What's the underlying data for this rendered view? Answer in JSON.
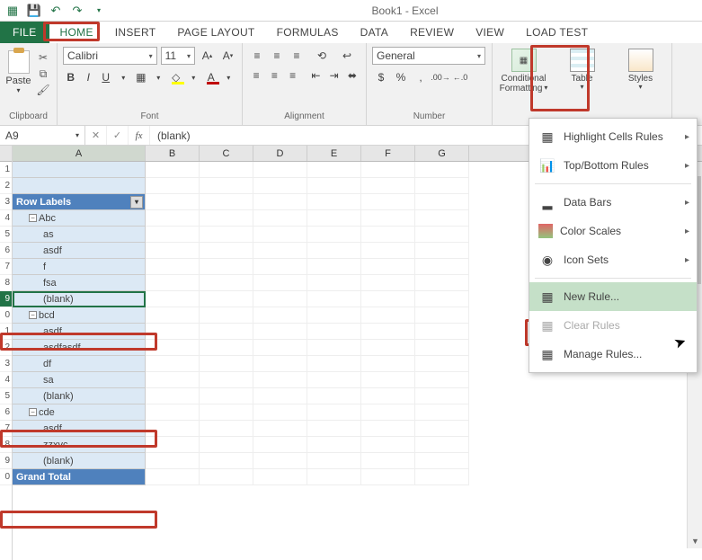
{
  "title": "Book1 - Excel",
  "tabs": {
    "file": "FILE",
    "home": "HOME",
    "insert": "INSERT",
    "pagelayout": "PAGE LAYOUT",
    "formulas": "FORMULAS",
    "data": "DATA",
    "review": "REVIEW",
    "view": "VIEW",
    "loadtest": "LOAD TEST"
  },
  "ribbon": {
    "paste": "Paste",
    "clipboard": "Clipboard",
    "font_name": "Calibri",
    "font_size": "11",
    "font": "Font",
    "alignment": "Alignment",
    "number_format": "General",
    "number": "Number",
    "conditional": "Conditional",
    "formatting": "Formatting",
    "format_table": "Table",
    "cell_styles": "Styles"
  },
  "namebox": "A9",
  "formula": "(blank)",
  "columns": [
    "A",
    "B",
    "C",
    "D",
    "E",
    "F",
    "G"
  ],
  "rows": [
    {
      "n": "1",
      "type": "blank"
    },
    {
      "n": "2",
      "type": "blank"
    },
    {
      "n": "3",
      "type": "hdr",
      "text": "Row Labels"
    },
    {
      "n": "4",
      "type": "g1",
      "text": "Abc"
    },
    {
      "n": "5",
      "type": "l2",
      "text": "as"
    },
    {
      "n": "6",
      "type": "l2",
      "text": "asdf"
    },
    {
      "n": "7",
      "type": "l2",
      "text": "f"
    },
    {
      "n": "8",
      "type": "l2",
      "text": "fsa"
    },
    {
      "n": "9",
      "type": "l2 sel",
      "text": "(blank)"
    },
    {
      "n": "0",
      "type": "g1",
      "text": "bcd"
    },
    {
      "n": "1",
      "type": "l2",
      "text": "asdf"
    },
    {
      "n": "2",
      "type": "l2",
      "text": "asdfasdf"
    },
    {
      "n": "3",
      "type": "l2",
      "text": "df"
    },
    {
      "n": "4",
      "type": "l2",
      "text": "sa"
    },
    {
      "n": "5",
      "type": "l2",
      "text": "(blank)"
    },
    {
      "n": "6",
      "type": "g1",
      "text": "cde"
    },
    {
      "n": "7",
      "type": "l2",
      "text": "asdf"
    },
    {
      "n": "8",
      "type": "l2",
      "text": "zzxvc"
    },
    {
      "n": "9",
      "type": "l2",
      "text": "(blank)"
    },
    {
      "n": "0",
      "type": "total",
      "text": "Grand Total"
    }
  ],
  "cf_menu": {
    "highlight": "Highlight Cells Rules",
    "topbottom": "Top/Bottom Rules",
    "databars": "Data Bars",
    "colorscales": "Color Scales",
    "iconsets": "Icon Sets",
    "newrule": "New Rule...",
    "clearrules": "Clear Rules",
    "managerules": "Manage Rules..."
  }
}
